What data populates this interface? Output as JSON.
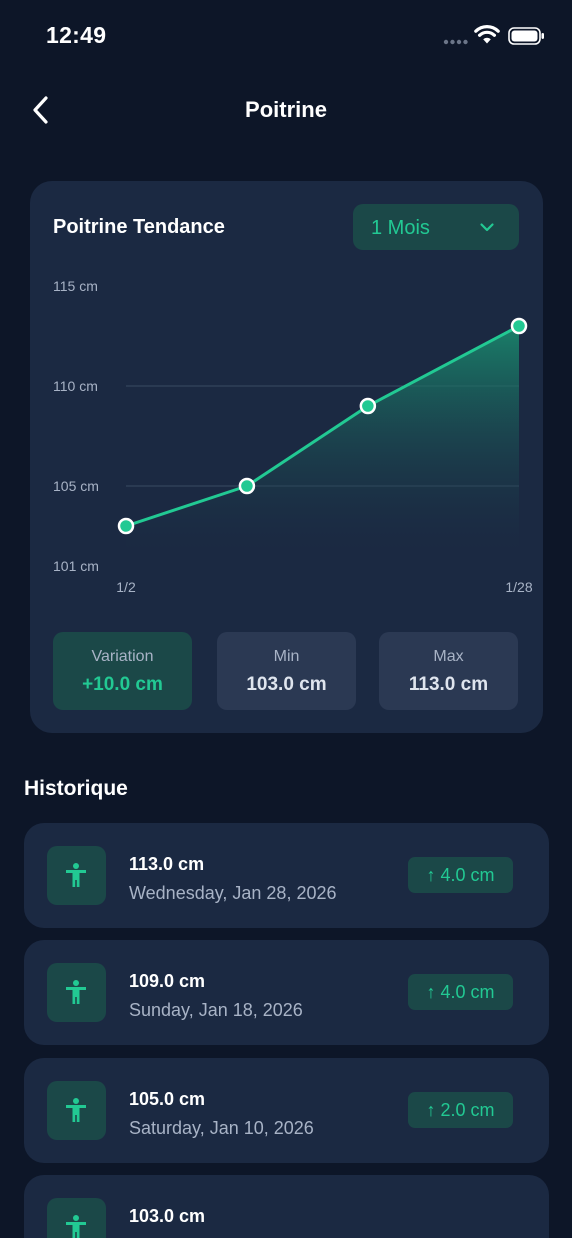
{
  "status_bar": {
    "time": "12:49"
  },
  "nav": {
    "title": "Poitrine"
  },
  "trend_card": {
    "title": "Poitrine Tendance",
    "period_select": {
      "selected": "1 Mois"
    },
    "stats": [
      {
        "label": "Variation",
        "value": "+10.0 cm",
        "accent": true
      },
      {
        "label": "Min",
        "value": "103.0 cm",
        "accent": false
      },
      {
        "label": "Max",
        "value": "113.0 cm",
        "accent": false
      }
    ]
  },
  "chart_data": {
    "type": "area",
    "x": [
      "1/2",
      "1/10",
      "1/18",
      "1/28"
    ],
    "y": [
      103.0,
      105.0,
      109.0,
      113.0
    ],
    "y_tick_labels": [
      "115 cm",
      "110 cm",
      "105 cm",
      "101 cm"
    ],
    "x_tick_labels": [
      "1/2",
      "1/28"
    ],
    "ylim": [
      101,
      115
    ],
    "grid": true,
    "line_color": "#22c993"
  },
  "history": {
    "title": "Historique",
    "items": [
      {
        "value": "113.0 cm",
        "date": "Wednesday, Jan 28, 2026",
        "change": "4.0 cm"
      },
      {
        "value": "109.0 cm",
        "date": "Sunday, Jan 18, 2026",
        "change": "4.0 cm"
      },
      {
        "value": "105.0 cm",
        "date": "Saturday, Jan 10, 2026",
        "change": "2.0 cm"
      },
      {
        "value": "103.0 cm",
        "date": "",
        "change": ""
      }
    ]
  },
  "colors": {
    "background": "#0d1628",
    "card": "#1b2942",
    "accent": "#22c993",
    "accent_bg": "#1b4848",
    "muted_text": "#a8b3c6"
  }
}
